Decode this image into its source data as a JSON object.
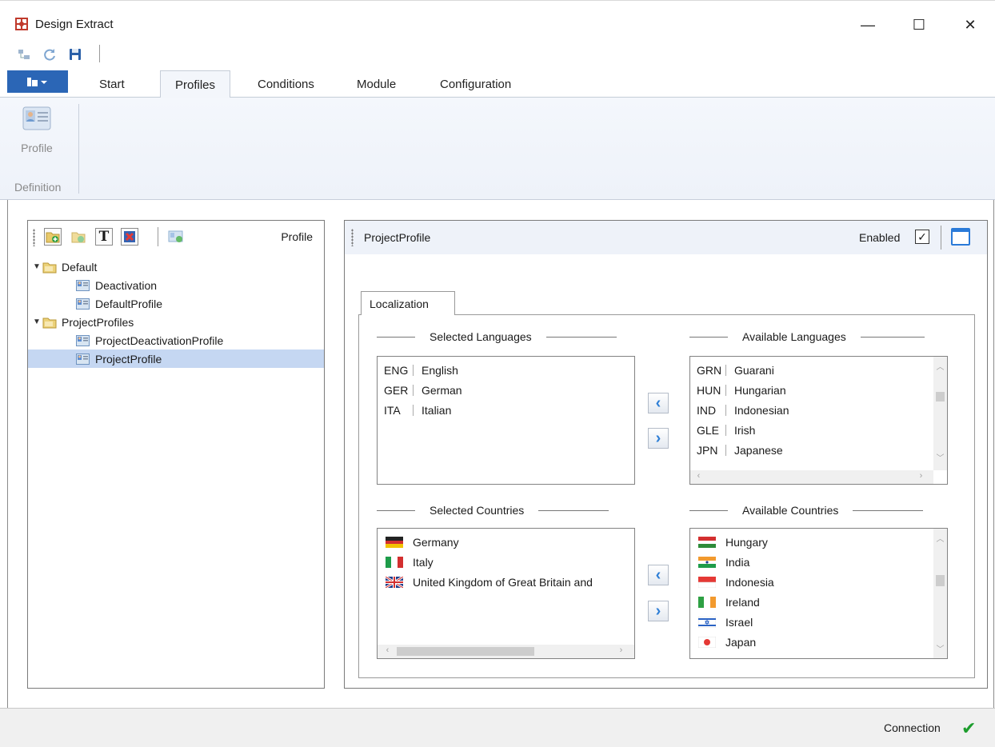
{
  "window": {
    "title": "Design Extract",
    "minimize_glyph": "—",
    "maximize_glyph": "☐",
    "close_glyph": "✕"
  },
  "ribbon": {
    "tabs": [
      {
        "label": "Start"
      },
      {
        "label": "Profiles"
      },
      {
        "label": "Conditions"
      },
      {
        "label": "Module"
      },
      {
        "label": "Configuration"
      }
    ],
    "active_tab": "Profiles",
    "profile_button_label": "Profile",
    "group_label": "Definition"
  },
  "left_panel": {
    "toolbar_label": "Profile",
    "text_button_glyph": "T",
    "tree": [
      {
        "label": "Default",
        "type": "folder",
        "expanded": true,
        "children": [
          "Deactivation",
          "DefaultProfile"
        ]
      },
      {
        "label": "ProjectProfiles",
        "type": "folder",
        "expanded": true,
        "children": [
          "ProjectDeactivationProfile",
          "ProjectProfile"
        ]
      }
    ],
    "selected": "ProjectProfile"
  },
  "right_panel": {
    "title": "ProjectProfile",
    "enabled_label": "Enabled",
    "enabled_checked": true,
    "check_glyph": "✓",
    "tab_label": "Localization",
    "selected_languages_header": "Selected Languages",
    "available_languages_header": "Available Languages",
    "selected_countries_header": "Selected Countries",
    "available_countries_header": "Available Countries",
    "selected_languages": [
      {
        "code": "ENG",
        "name": "English"
      },
      {
        "code": "GER",
        "name": "German"
      },
      {
        "code": "ITA",
        "name": "Italian"
      }
    ],
    "available_languages": [
      {
        "code": "GRN",
        "name": "Guarani"
      },
      {
        "code": "HUN",
        "name": "Hungarian"
      },
      {
        "code": "IND",
        "name": "Indonesian"
      },
      {
        "code": "GLE",
        "name": "Irish"
      },
      {
        "code": "JPN",
        "name": "Japanese"
      }
    ],
    "selected_countries": [
      {
        "name": "Germany",
        "flag": "de"
      },
      {
        "name": "Italy",
        "flag": "it"
      },
      {
        "name": "United Kingdom of Great Britain and",
        "flag": "gb"
      }
    ],
    "available_countries": [
      {
        "name": "Hungary",
        "flag": "hu"
      },
      {
        "name": "India",
        "flag": "in"
      },
      {
        "name": "Indonesia",
        "flag": "id"
      },
      {
        "name": "Ireland",
        "flag": "ie"
      },
      {
        "name": "Israel",
        "flag": "il"
      },
      {
        "name": "Japan",
        "flag": "jp"
      }
    ],
    "move_left_glyph": "‹",
    "move_right_glyph": "›"
  },
  "statusbar": {
    "connection_label": "Connection",
    "connection_ok_glyph": "✔"
  },
  "colors": {
    "accent": "#2b66b6",
    "selection": "#c5d7f2",
    "status_ok": "#1d9d2d"
  }
}
